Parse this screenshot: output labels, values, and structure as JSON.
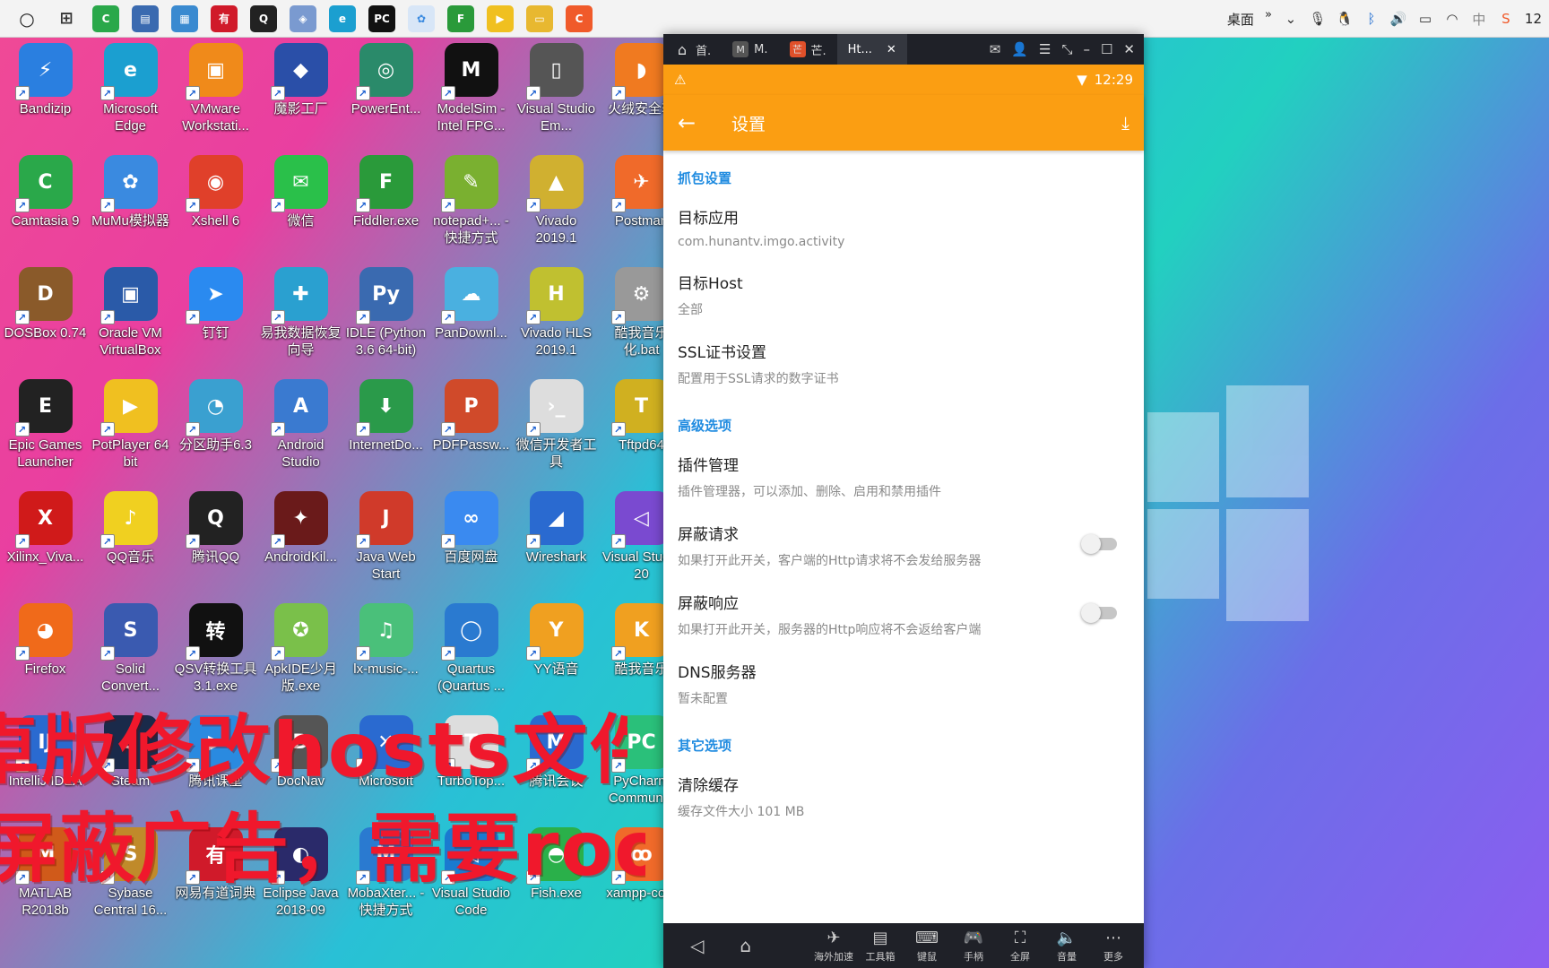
{
  "taskbar": {
    "right_label": "桌面",
    "clock": "12",
    "overflow": "»"
  },
  "desktop": {
    "icons": [
      {
        "label": "Bandizip",
        "color": "#2a7fe0",
        "glyph": "⚡"
      },
      {
        "label": "Microsoft Edge",
        "color": "#1b9fd0",
        "glyph": "e"
      },
      {
        "label": "VMware Workstati...",
        "color": "#f08a1a",
        "glyph": "▣"
      },
      {
        "label": "魔影工厂",
        "color": "#2a4fa8",
        "glyph": "◆"
      },
      {
        "label": "PowerEnt...",
        "color": "#2a8a6a",
        "glyph": "◎"
      },
      {
        "label": "ModelSim - Intel FPG...",
        "color": "#111111",
        "glyph": "M"
      },
      {
        "label": "Visual Studio Em...",
        "color": "#555555",
        "glyph": "▯"
      },
      {
        "label": "火绒安全软",
        "color": "#f07a20",
        "glyph": "◗"
      },
      {
        "label": "Camtasia 9",
        "color": "#2aa84a",
        "glyph": "C"
      },
      {
        "label": "MuMu模拟器",
        "color": "#3a8ae0",
        "glyph": "✿"
      },
      {
        "label": "Xshell 6",
        "color": "#e0402a",
        "glyph": "◉"
      },
      {
        "label": "微信",
        "color": "#2ac04a",
        "glyph": "✉"
      },
      {
        "label": "Fiddler.exe",
        "color": "#2a9a3a",
        "glyph": "F"
      },
      {
        "label": "notepad+... - 快捷方式",
        "color": "#7ab030",
        "glyph": "✎"
      },
      {
        "label": "Vivado 2019.1",
        "color": "#d0b030",
        "glyph": "▲"
      },
      {
        "label": "Postman",
        "color": "#f06a2a",
        "glyph": "✈"
      },
      {
        "label": "DOSBox 0.74",
        "color": "#8a5a2a",
        "glyph": "D"
      },
      {
        "label": "Oracle VM VirtualBox",
        "color": "#2a5aa8",
        "glyph": "▣"
      },
      {
        "label": "钉钉",
        "color": "#2a8af0",
        "glyph": "➤"
      },
      {
        "label": "易我数据恢复向导",
        "color": "#2aa0d0",
        "glyph": "✚"
      },
      {
        "label": "IDLE (Python 3.6 64-bit)",
        "color": "#3a6ab0",
        "glyph": "Py"
      },
      {
        "label": "PanDownl...",
        "color": "#4ab0e0",
        "glyph": "☁"
      },
      {
        "label": "Vivado HLS 2019.1",
        "color": "#c0c030",
        "glyph": "H"
      },
      {
        "label": "酷我音乐化.bat",
        "color": "#999999",
        "glyph": "⚙"
      },
      {
        "label": "Epic Games Launcher",
        "color": "#222222",
        "glyph": "E"
      },
      {
        "label": "PotPlayer 64 bit",
        "color": "#f0c020",
        "glyph": "▶"
      },
      {
        "label": "分区助手6.3",
        "color": "#3aa0d0",
        "glyph": "◔"
      },
      {
        "label": "Android Studio",
        "color": "#3a7ad0",
        "glyph": "A"
      },
      {
        "label": "InternetDo...",
        "color": "#2a9a4a",
        "glyph": "⬇"
      },
      {
        "label": "PDFPassw...",
        "color": "#d04a2a",
        "glyph": "P"
      },
      {
        "label": "微信开发者工具",
        "color": "#dddddd",
        "glyph": "›_"
      },
      {
        "label": "Tftpd64",
        "color": "#d0b020",
        "glyph": "T"
      },
      {
        "label": "Xilinx_Viva...",
        "color": "#d01a1a",
        "glyph": "X"
      },
      {
        "label": "QQ音乐",
        "color": "#f0d020",
        "glyph": "♪"
      },
      {
        "label": "腾讯QQ",
        "color": "#222222",
        "glyph": "Q"
      },
      {
        "label": "AndroidKil...",
        "color": "#6a1a1a",
        "glyph": "✦"
      },
      {
        "label": "Java Web Start",
        "color": "#d03a2a",
        "glyph": "J"
      },
      {
        "label": "百度网盘",
        "color": "#3a8af0",
        "glyph": "∞"
      },
      {
        "label": "Wireshark",
        "color": "#2a6ad0",
        "glyph": "◢"
      },
      {
        "label": "Visual Studio 20",
        "color": "#7a4ad0",
        "glyph": "◁"
      },
      {
        "label": "Firefox",
        "color": "#f06a1a",
        "glyph": "◕"
      },
      {
        "label": "Solid Convert...",
        "color": "#3a5ab0",
        "glyph": "S"
      },
      {
        "label": "QSV转换工具3.1.exe",
        "color": "#111111",
        "glyph": "转"
      },
      {
        "label": "ApkIDE少月版.exe",
        "color": "#7ac04a",
        "glyph": "✪"
      },
      {
        "label": "lx-music-...",
        "color": "#4ac07a",
        "glyph": "♫"
      },
      {
        "label": "Quartus (Quartus ...",
        "color": "#2a7ad0",
        "glyph": "◯"
      },
      {
        "label": "YY语音",
        "color": "#f0a020",
        "glyph": "Y"
      },
      {
        "label": "酷我音乐",
        "color": "#f0a020",
        "glyph": "K"
      },
      {
        "label": "IntelliJ IDEA",
        "color": "#2a6ad0",
        "glyph": "IJ"
      },
      {
        "label": "Steam",
        "color": "#1a2a4a",
        "glyph": "S"
      },
      {
        "label": "腾讯课堂",
        "color": "#2a8ae0",
        "glyph": "▶"
      },
      {
        "label": "DocNav",
        "color": "#555555",
        "glyph": "D"
      },
      {
        "label": "Microsoft",
        "color": "#2a6ad0",
        "glyph": "✕"
      },
      {
        "label": "TurboTop...",
        "color": "#dddddd",
        "glyph": "T"
      },
      {
        "label": "腾讯会议",
        "color": "#2a6ad0",
        "glyph": "M"
      },
      {
        "label": "PyCharm Commun...",
        "color": "#2ac07a",
        "glyph": "PC"
      },
      {
        "label": "MATLAB R2018b",
        "color": "#d05a1a",
        "glyph": "M"
      },
      {
        "label": "Sybase Central 16...",
        "color": "#c08a2a",
        "glyph": "S"
      },
      {
        "label": "网易有道词典",
        "color": "#d01a2a",
        "glyph": "有"
      },
      {
        "label": "Eclipse Java 2018-09",
        "color": "#2a2a6a",
        "glyph": "◐"
      },
      {
        "label": "MobaXter... - 快捷方式",
        "color": "#2a7ad0",
        "glyph": "M"
      },
      {
        "label": "Visual Studio Code",
        "color": "#1a7ad0",
        "glyph": "◁"
      },
      {
        "label": "Fish.exe",
        "color": "#2ab04a",
        "glyph": "◓"
      },
      {
        "label": "xampp-co...",
        "color": "#f06a2a",
        "glyph": "ꝏ"
      }
    ],
    "overlay_line1": "卓版修改hosts文件",
    "overlay_line2": "屏蔽广告，需要root"
  },
  "emulator": {
    "tabs": [
      {
        "label": "首.",
        "glyph": "⌂"
      },
      {
        "label": "M.",
        "glyph": "M"
      },
      {
        "label": "芒.",
        "glyph": "芒"
      },
      {
        "label": "Ht...",
        "glyph": ""
      }
    ],
    "status_time": "12:29",
    "appbar_title": "设置",
    "sections": [
      {
        "header": "抓包设置",
        "items": [
          {
            "title": "目标应用",
            "subtitle": "com.hunantv.imgo.activity"
          },
          {
            "title": "目标Host",
            "subtitle": "全部"
          },
          {
            "title": "SSL证书设置",
            "subtitle": "配置用于SSL请求的数字证书"
          }
        ]
      },
      {
        "header": "高级选项",
        "items": [
          {
            "title": "插件管理",
            "subtitle": "插件管理器，可以添加、删除、启用和禁用插件"
          },
          {
            "title": "屏蔽请求",
            "subtitle": "如果打开此开关，客户端的Http请求将不会发给服务器",
            "toggle": false
          },
          {
            "title": "屏蔽响应",
            "subtitle": "如果打开此开关，服务器的Http响应将不会返给客户端",
            "toggle": false
          },
          {
            "title": "DNS服务器",
            "subtitle": "暂未配置"
          }
        ]
      },
      {
        "header": "其它选项",
        "items": [
          {
            "title": "清除缓存",
            "subtitle": "缓存文件大小 101 MB"
          }
        ]
      }
    ],
    "nav_tools": [
      {
        "label": "海外加速",
        "glyph": "✈"
      },
      {
        "label": "工具箱",
        "glyph": "▤"
      },
      {
        "label": "键鼠",
        "glyph": "⌨"
      },
      {
        "label": "手柄",
        "glyph": "🎮"
      },
      {
        "label": "全屏",
        "glyph": "⛶"
      },
      {
        "label": "音量",
        "glyph": "🔈"
      },
      {
        "label": "更多",
        "glyph": "⋯"
      }
    ]
  }
}
